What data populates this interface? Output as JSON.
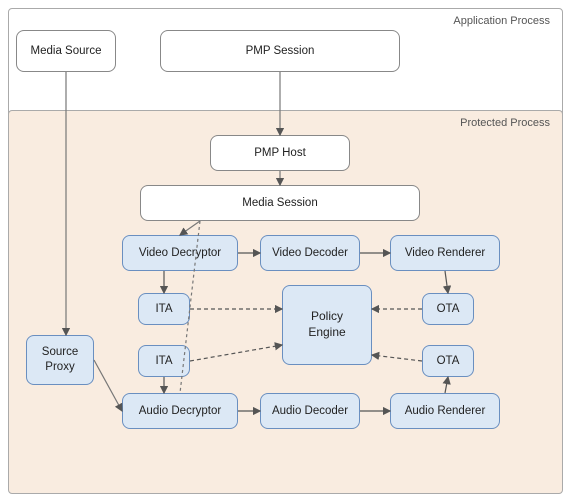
{
  "labels": {
    "app_process": "Application Process",
    "protected_process": "Protected Process",
    "media_source": "Media Source",
    "pmp_session": "PMP Session",
    "pmp_host": "PMP Host",
    "media_session": "Media Session",
    "video_decryptor": "Video Decryptor",
    "video_decoder": "Video Decoder",
    "video_renderer": "Video Renderer",
    "ita_top": "ITA",
    "ota_top": "OTA",
    "policy_engine": "Policy\nEngine",
    "ita_bottom": "ITA",
    "ota_bottom": "OTA",
    "audio_decryptor": "Audio Decryptor",
    "audio_decoder": "Audio Decoder",
    "audio_renderer": "Audio Renderer",
    "source_proxy": "Source\nProxy"
  }
}
